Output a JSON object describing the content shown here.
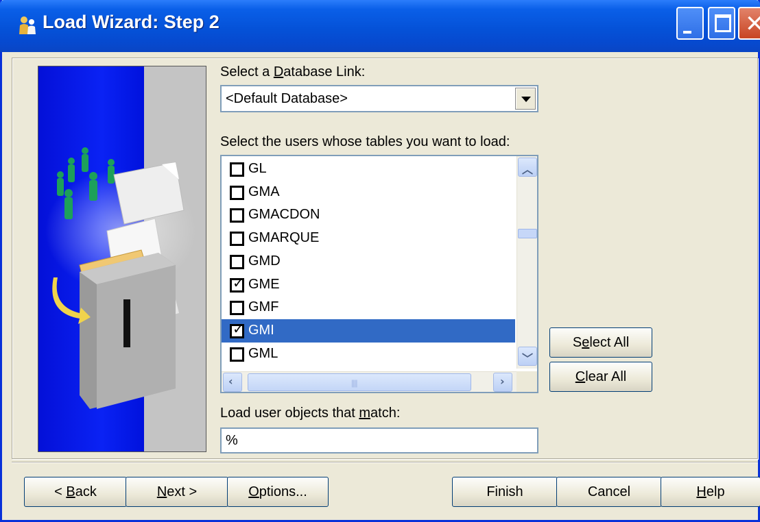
{
  "window": {
    "title": "Load Wizard: Step 2",
    "icon": "wizard-users-icon"
  },
  "db_link": {
    "label_before": "Select a ",
    "label_mnemonic": "D",
    "label_after": "atabase Link:",
    "value": "<Default Database>"
  },
  "users": {
    "label": "Select the users whose tables you want to load:",
    "items": [
      {
        "name": "GL",
        "checked": false,
        "selected": false
      },
      {
        "name": "GMA",
        "checked": false,
        "selected": false
      },
      {
        "name": "GMACDON",
        "checked": false,
        "selected": false
      },
      {
        "name": "GMARQUE",
        "checked": false,
        "selected": false
      },
      {
        "name": "GMD",
        "checked": false,
        "selected": false
      },
      {
        "name": "GME",
        "checked": true,
        "selected": false
      },
      {
        "name": "GMF",
        "checked": false,
        "selected": false
      },
      {
        "name": "GMI",
        "checked": true,
        "selected": true
      },
      {
        "name": "GML",
        "checked": false,
        "selected": false
      }
    ]
  },
  "select_all": {
    "before": "S",
    "mnemonic": "e",
    "after": "lect All"
  },
  "clear_all": {
    "before": "",
    "mnemonic": "C",
    "after": "lear All"
  },
  "filter": {
    "label_before": "Load user objects that ",
    "label_mnemonic": "m",
    "label_after": "atch:",
    "value": "%"
  },
  "footer": {
    "back": {
      "before": "< ",
      "mnemonic": "B",
      "after": "ack"
    },
    "next": {
      "before": "",
      "mnemonic": "N",
      "after": "ext >"
    },
    "options": {
      "before": "",
      "mnemonic": "O",
      "after": "ptions..."
    },
    "finish": "Finish",
    "cancel": "Cancel",
    "help": {
      "before": "",
      "mnemonic": "H",
      "after": "elp"
    }
  },
  "colors": {
    "titlebar": "#0552d8",
    "selection": "#316ac5",
    "dialog_bg": "#ece9d8"
  }
}
